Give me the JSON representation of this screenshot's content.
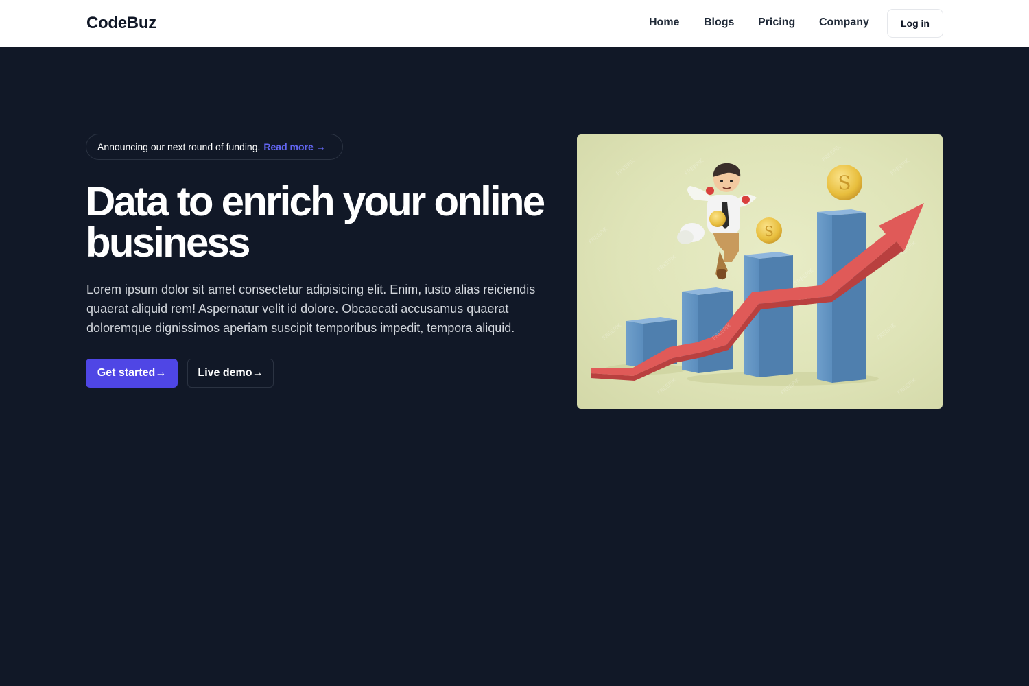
{
  "nav": {
    "brand": "CodeBuz",
    "links": [
      "Home",
      "Blogs",
      "Pricing",
      "Company"
    ],
    "login_label": "Log in"
  },
  "hero": {
    "announcement": "Announcing our next round of funding.",
    "announcement_link": "Read more →",
    "headline_line1": "Data to enrich your online",
    "headline_line2": "business",
    "description": "Lorem ipsum dolor sit amet consectetur adipisicing elit. Enim, iusto alias reiciendis quaerat aliquid rem! Aspernatur velit id dolore. Obcaecati accusamus quaerat doloremque dignissimos aperiam suscipit temporibus impedit, tempora aliquid.",
    "primary_button": "Get started→",
    "secondary_button": "Live demo→",
    "image_icon": "growth-chart-illustration"
  },
  "colors": {
    "nav_bg": "#ffffff",
    "page_bg": "#111827",
    "accent": "#4f46e5",
    "link_accent": "#6366f1",
    "text_light": "#d1d5db"
  }
}
